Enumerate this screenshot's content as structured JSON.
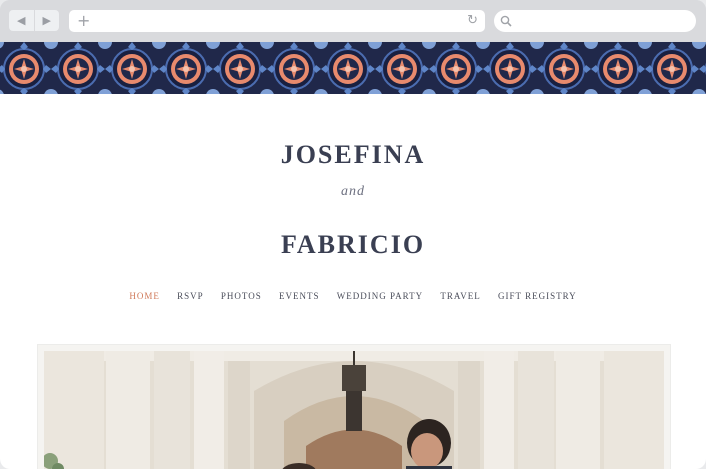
{
  "browser": {
    "back_icon": "back-arrow-icon",
    "forward_icon": "forward-arrow-icon",
    "new_tab_icon": "plus-icon",
    "reload_icon": "reload-icon",
    "search_icon": "search-icon"
  },
  "site": {
    "name_one": "JOSEFINA",
    "connector": "and",
    "name_two": "FABRICIO",
    "nav": [
      {
        "label": "HOME",
        "active": true
      },
      {
        "label": "RSVP",
        "active": false
      },
      {
        "label": "PHOTOS",
        "active": false
      },
      {
        "label": "EVENTS",
        "active": false
      },
      {
        "label": "WEDDING PARTY",
        "active": false
      },
      {
        "label": "TRAVEL",
        "active": false
      },
      {
        "label": "GIFT REGISTRY",
        "active": false
      }
    ]
  },
  "colors": {
    "tile_navy": "#20284a",
    "tile_coral": "#e88a6d",
    "tile_blue": "#4b6cb0",
    "heading": "#3a3f52",
    "nav_active": "#d07a5a"
  }
}
